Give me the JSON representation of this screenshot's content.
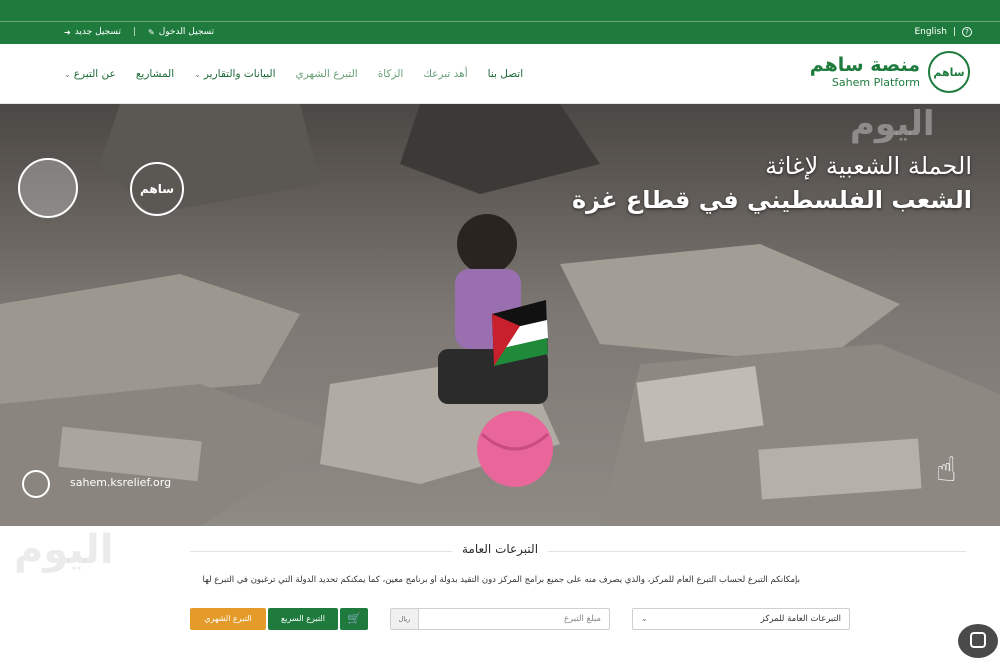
{
  "topbar": {
    "register": "تسجيل جديد",
    "login": "تسجيل الدخول",
    "language": "English",
    "help_icon": "question-icon",
    "bg_color": "#1e7b3d"
  },
  "nav": {
    "logo_ar": "منصة ساهم",
    "logo_en": "Sahem Platform",
    "logo_mark": "ساهم",
    "menu": [
      {
        "label": "عن التبرع",
        "has_dropdown": true
      },
      {
        "label": "المشاريع",
        "has_dropdown": false
      },
      {
        "label": "البيانات والتقارير",
        "has_dropdown": true
      },
      {
        "label": "التبرع الشهري",
        "has_dropdown": false
      },
      {
        "label": "الزكاة",
        "has_dropdown": false
      },
      {
        "label": "أهد تبرعك",
        "has_dropdown": false
      },
      {
        "label": "اتصل بنا",
        "has_dropdown": false
      }
    ]
  },
  "hero": {
    "title_line1": "الحملة الشعبية لإغاثة",
    "title_line2": "الشعب الفلسطيني في قطاع غزة",
    "url": "sahem.ksrelief.org",
    "logo_mark": "ساهم",
    "watermark": "اليوم"
  },
  "donation": {
    "section_title": "التبرعات العامة",
    "description": "بإمكانكم التبرع لحساب التبرع العام للمركز، والذي يصرف منه على جميع برامج المركز دون التقيد بدولة أو برنامج معين، كما يمكنكم تحديد الدولة التي ترغبون في التبرع لها",
    "select_value": "التبرعات العامة للمركز",
    "amount_placeholder": "مبلغ التبرع",
    "currency": "ريال",
    "quick_donate": "التبرع السريع",
    "monthly_donate": "التبرع الشهري",
    "accent_color": "#1e7b3d",
    "monthly_color": "#e59b2a"
  },
  "watermark": {
    "text": "اليوم"
  }
}
